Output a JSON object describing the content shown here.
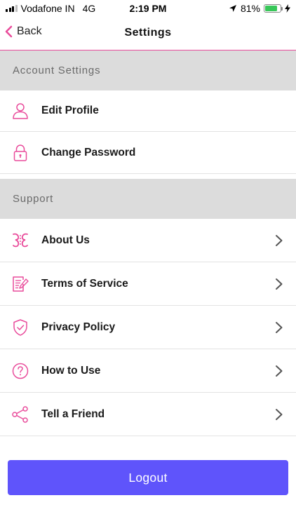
{
  "status_bar": {
    "carrier": "Vodafone IN",
    "network": "4G",
    "time": "2:19 PM",
    "battery_percent": "81%",
    "battery_level": 0.81
  },
  "nav": {
    "back_label": "Back",
    "title": "Settings"
  },
  "sections": {
    "account": {
      "label": "Account Settings",
      "items": [
        {
          "label": "Edit Profile",
          "icon": "user-icon"
        },
        {
          "label": "Change Password",
          "icon": "lock-icon"
        }
      ]
    },
    "support": {
      "label": "Support",
      "items": [
        {
          "label": "About Us",
          "icon": "app-logo-icon"
        },
        {
          "label": "Terms of Service",
          "icon": "document-edit-icon"
        },
        {
          "label": "Privacy Policy",
          "icon": "shield-check-icon"
        },
        {
          "label": "How to Use",
          "icon": "question-circle-icon"
        },
        {
          "label": "Tell a Friend",
          "icon": "share-icon"
        }
      ]
    }
  },
  "logout_label": "Logout",
  "colors": {
    "accent": "#e94c9b",
    "logout": "#5f54fb",
    "section_bg": "#dcdcdc",
    "battery": "#38c759"
  }
}
